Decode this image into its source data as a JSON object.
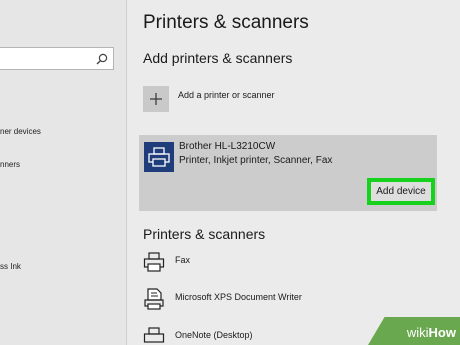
{
  "sidebar": {
    "search_placeholder": "",
    "items": [
      {
        "label": "ner devices"
      },
      {
        "label": "nners"
      },
      {
        "label": "ss Ink"
      }
    ]
  },
  "main": {
    "title": "Printers & scanners",
    "add_section": {
      "heading": "Add printers & scanners",
      "add_label": "Add a printer or scanner"
    },
    "discovered_device": {
      "name": "Brother HL-L3210CW",
      "description": "Printer, Inkjet printer, Scanner, Fax",
      "action_label": "Add device",
      "icon": "printer-icon"
    },
    "installed_section": {
      "heading": "Printers & scanners",
      "items": [
        {
          "label": "Fax",
          "icon": "fax-icon"
        },
        {
          "label": "Microsoft XPS Document Writer",
          "icon": "document-printer-icon"
        },
        {
          "label": "OneNote (Desktop)",
          "icon": "printer-icon"
        }
      ]
    }
  },
  "watermark": {
    "part1": "wiki",
    "part2": "How"
  },
  "colors": {
    "highlight": "#17d21c",
    "device_icon_bg": "#1f3d7a",
    "sidebar_bg": "#e6e6e6",
    "main_bg": "#ebebeb"
  }
}
